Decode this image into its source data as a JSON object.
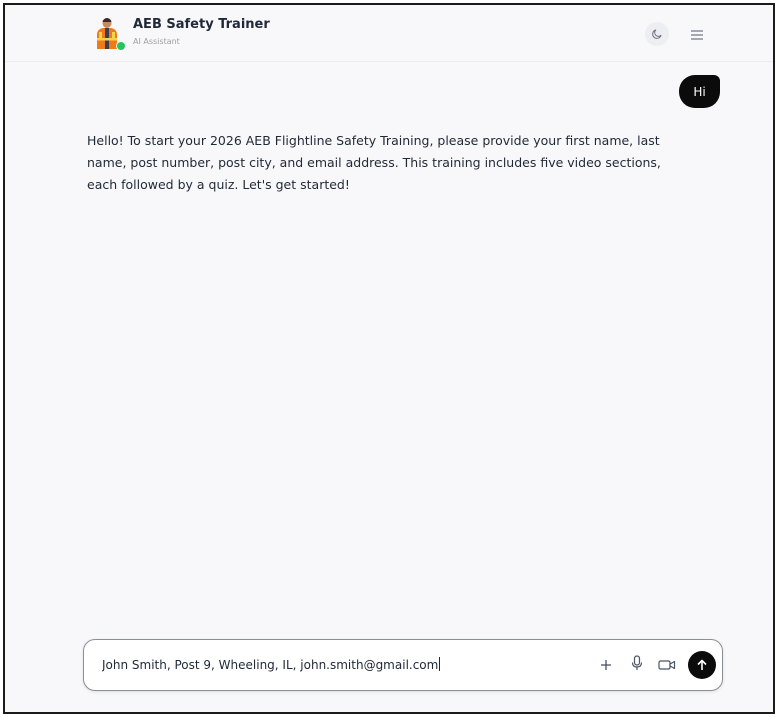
{
  "header": {
    "title": "AEB Safety Trainer",
    "subtitle": "AI Assistant",
    "avatar_icon": "safety-worker-avatar",
    "status": "online",
    "theme_toggle_icon": "moon-icon",
    "menu_icon": "hamburger-menu-icon"
  },
  "messages": [
    {
      "role": "user",
      "text": "Hi"
    },
    {
      "role": "assistant",
      "text": "Hello! To start your 2026 AEB Flightline Safety Training, please provide your first name, last name, post number, post city, and email address. This training includes five video sections, each followed by a quiz. Let's get started!"
    }
  ],
  "composer": {
    "value": "John Smith, Post 9, Wheeling, IL, john.smith@gmail.com",
    "attach_icon": "plus-icon",
    "mic_icon": "microphone-icon",
    "video_icon": "video-camera-icon",
    "send_icon": "arrow-up-icon"
  },
  "colors": {
    "background": "#f8f8fa",
    "text": "#1f2937",
    "user_bubble": "#0b0b0b",
    "status_online": "#22c55e"
  }
}
